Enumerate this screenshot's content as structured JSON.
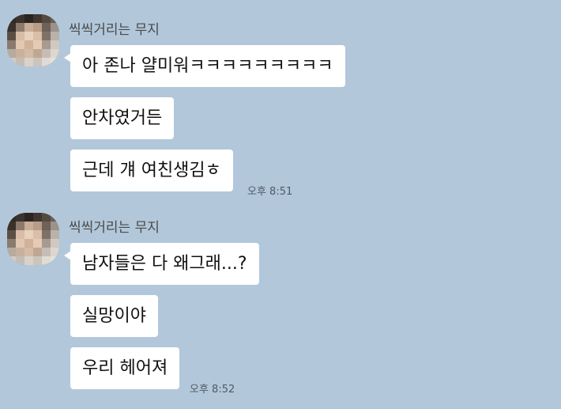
{
  "chat": {
    "background_color": "#b2c7da",
    "bubble_color": "#ffffff",
    "groups": [
      {
        "sender": "씩씩거리는 무지",
        "messages": [
          "아 존나 얄미워ㅋㅋㅋㅋㅋㅋㅋㅋㅋ",
          "안차였거든",
          "근데 걔 여친생김ㅎ"
        ],
        "time": "오후 8:51"
      },
      {
        "sender": "씩씩거리는 무지",
        "messages": [
          "남자들은 다 왜그래...?",
          "실망이야",
          "우리 헤어져"
        ],
        "time": "오후 8:52"
      }
    ]
  }
}
